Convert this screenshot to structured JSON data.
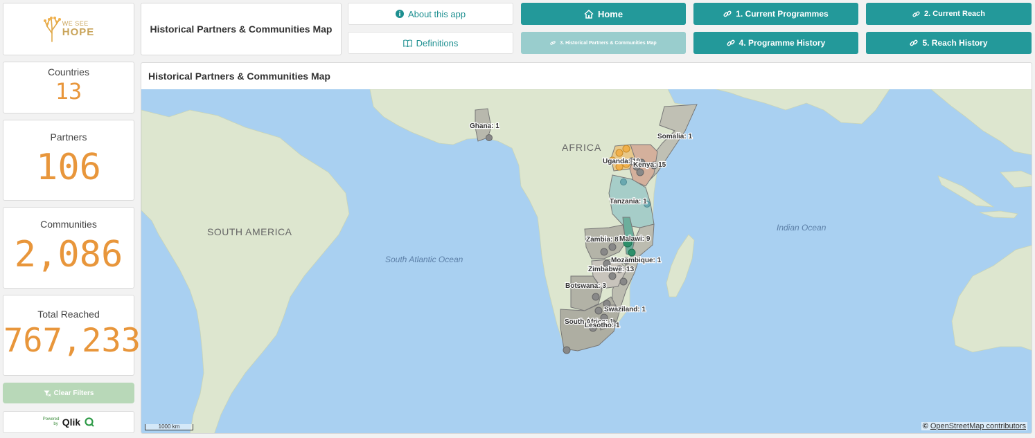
{
  "logo": {
    "line1": "WE SEE",
    "line2": "HOPE"
  },
  "header": {
    "title": "Historical Partners & Communities Map"
  },
  "nav": {
    "about": "About this app",
    "definitions": "Definitions",
    "home": "Home",
    "current_programmes": "1. Current Programmes",
    "current_reach": "2. Current Reach",
    "historical_map": "3. Historical Partners & Communities Map",
    "programme_history": "4. Programme History",
    "reach_history": "5. Reach History"
  },
  "kpis": {
    "countries": {
      "label": "Countries",
      "value": "13"
    },
    "partners": {
      "label": "Partners",
      "value": "106"
    },
    "communities": {
      "label": "Communities",
      "value": "2,086"
    },
    "total_reached": {
      "label": "Total Reached",
      "value": "767,233"
    }
  },
  "clear_filters": "Clear Filters",
  "qlik": {
    "powered": "Powered by",
    "brand": "Qlik"
  },
  "map": {
    "title": "Historical Partners & Communities Map",
    "continent_labels": {
      "africa": "AFRICA",
      "south_america": "SOUTH AMERICA"
    },
    "ocean_labels": {
      "atlantic": "South Atlantic Ocean",
      "indian": "Indian Ocean"
    },
    "country_labels": [
      "Ghana: 1",
      "Somalia: 1",
      "Uganda: 19",
      "Kenya: 15",
      "Tanzania: 1",
      "Zambia: 8",
      "Malawi: 9",
      "Mozambique: 1",
      "Zimbabwe: 13",
      "Botswana: 3",
      "Swaziland: 1",
      "South Africa: 1",
      "Lesotho: 1"
    ],
    "scale": "1000 km",
    "attribution_prefix": "©",
    "attribution": "OpenStreetMap contributors"
  },
  "colors": {
    "accent": "#23999a",
    "kpi_value": "#e8963b",
    "ocean": "#a9d0f1",
    "land": "#dde6cf"
  }
}
